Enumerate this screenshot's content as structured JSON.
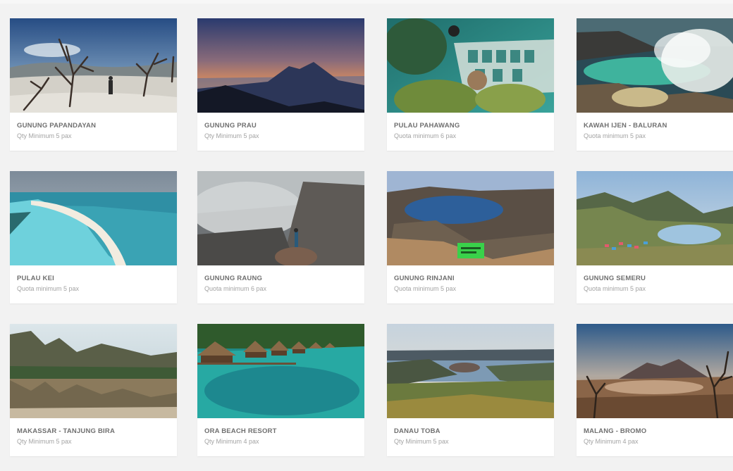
{
  "tours": [
    {
      "title": "GUNUNG PAPANDAYAN",
      "subtitle": "Qty Minimum 5 pax",
      "image": "dead-trees-volcanic-crater-photo"
    },
    {
      "title": "GUNUNG PRAU",
      "subtitle": "Qty Minimum 5 pax",
      "image": "mountain-sunrise-photo"
    },
    {
      "title": "PULAU PAHAWANG",
      "subtitle": "Quota minimum 6 pax",
      "image": "underwater-coral-sign-photo"
    },
    {
      "title": "KAWAH IJEN - BALURAN",
      "subtitle": "Quota minimum 5 pax",
      "image": "crater-lake-smoke-photo"
    },
    {
      "title": "PULAU KEI",
      "subtitle": "Quota minimum 5 pax",
      "image": "white-sand-beach-photo"
    },
    {
      "title": "GUNUNG RAUNG",
      "subtitle": "Quota minimum 6 pax",
      "image": "volcano-crater-mist-photo"
    },
    {
      "title": "GUNUNG RINJANI",
      "subtitle": "Quota minimum 5 pax",
      "image": "crater-lake-hiker-photo"
    },
    {
      "title": "GUNUNG SEMERU",
      "subtitle": "Quota minimum 5 pax",
      "image": "mountain-lake-camp-photo"
    },
    {
      "title": "MAKASSAR - TANJUNG BIRA",
      "subtitle": "Qty Minimum 5 pax",
      "image": "karst-cliffs-reflection-photo"
    },
    {
      "title": "ORA BEACH RESORT",
      "subtitle": "Qty Minimum 4 pax",
      "image": "overwater-bungalows-photo"
    },
    {
      "title": "DANAU TOBA",
      "subtitle": "Qty Minimum 5 pax",
      "image": "lake-toba-panorama-photo"
    },
    {
      "title": "MALANG - BROMO",
      "subtitle": "Qty Minimum 4 pax",
      "image": "bromo-volcano-sunrise-photo"
    }
  ],
  "colors": {
    "background": "#f2f2f2",
    "card": "#ffffff",
    "title": "#6f6f6f",
    "subtitle": "#a3a3a3"
  }
}
